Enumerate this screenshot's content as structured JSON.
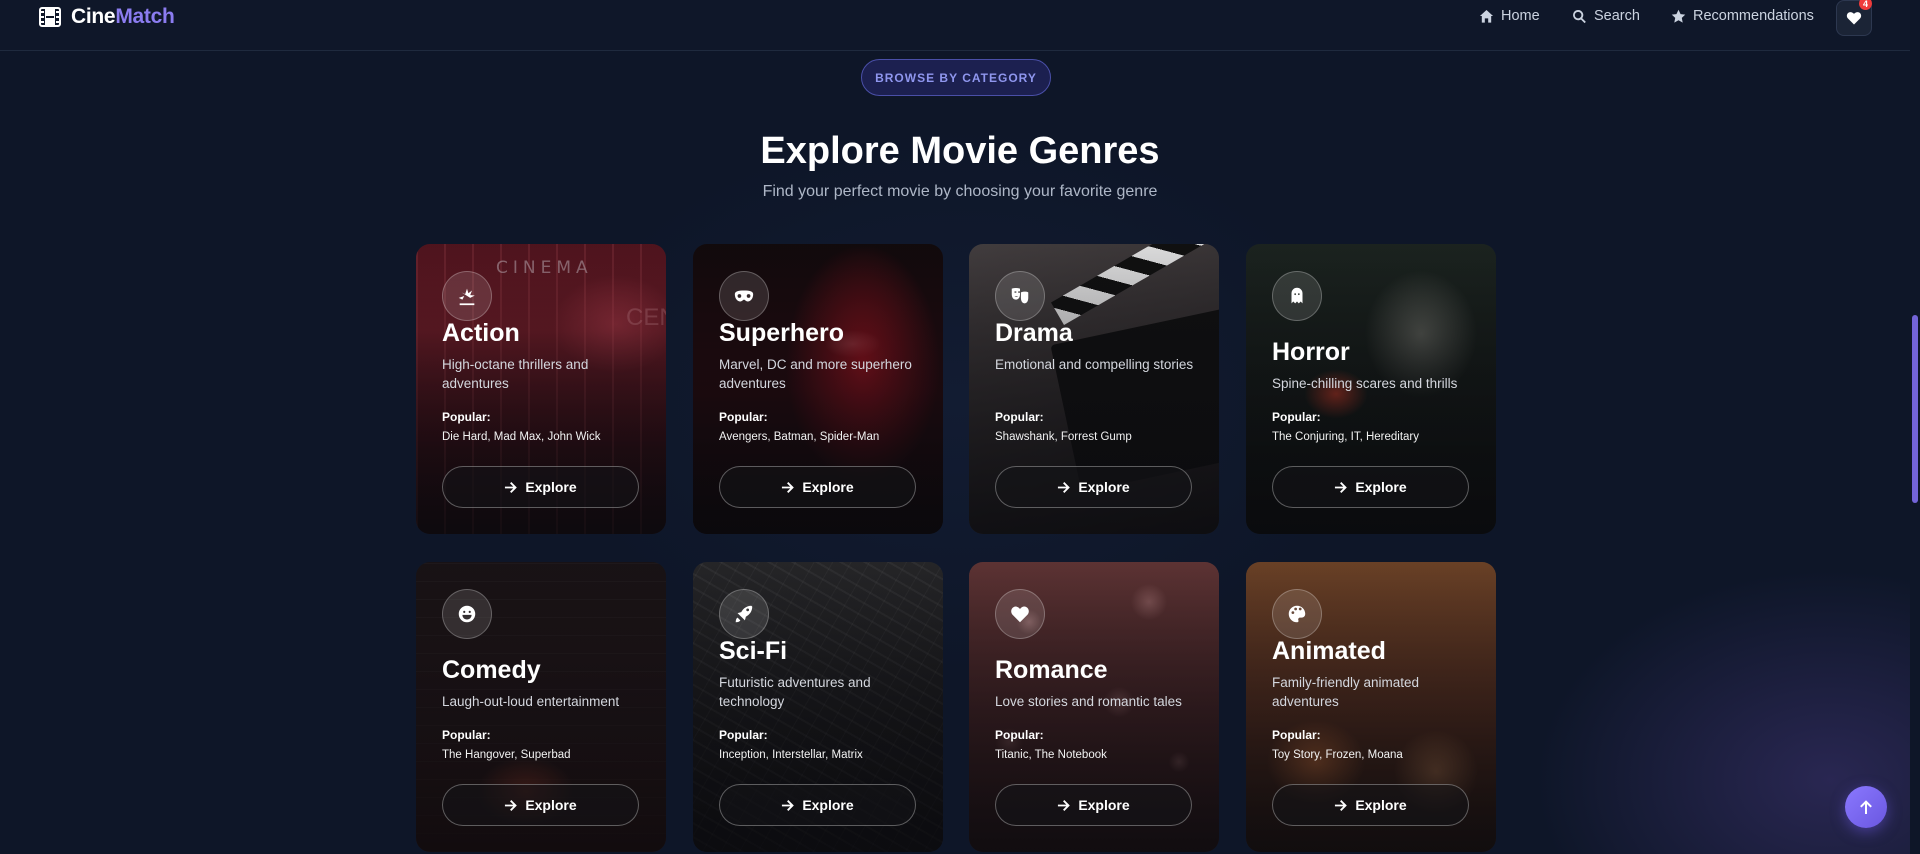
{
  "nav": {
    "brand_a": "Cine",
    "brand_b": "Match",
    "links": [
      {
        "label": "Home",
        "icon": "home-icon"
      },
      {
        "label": "Search",
        "icon": "search-icon"
      },
      {
        "label": "Recommendations",
        "icon": "star-icon"
      }
    ],
    "favorites_count": "4"
  },
  "header": {
    "pill": "BROWSE BY CATEGORY",
    "title": "Explore Movie Genres",
    "subtitle": "Find your perfect movie by choosing your favorite genre"
  },
  "popular_label": "Popular:",
  "explore_label": "Explore",
  "genres": [
    {
      "name": "Action",
      "desc": "High-octane thrillers and adventures",
      "popular": "Die Hard, Mad Max, John Wick",
      "icon": "explosion-icon"
    },
    {
      "name": "Superhero",
      "desc": "Marvel, DC and more superhero adventures",
      "popular": "Avengers, Batman, Spider-Man",
      "icon": "mask-icon"
    },
    {
      "name": "Drama",
      "desc": "Emotional and compelling stories",
      "popular": "Shawshank, Forrest Gump",
      "icon": "theater-masks-icon"
    },
    {
      "name": "Horror",
      "desc": "Spine-chilling scares and thrills",
      "popular": "The Conjuring, IT, Hereditary",
      "icon": "ghost-icon"
    },
    {
      "name": "Comedy",
      "desc": "Laugh-out-loud entertainment",
      "popular": "The Hangover, Superbad",
      "icon": "laugh-icon"
    },
    {
      "name": "Sci-Fi",
      "desc": "Futuristic adventures and technology",
      "popular": "Inception, Interstellar, Matrix",
      "icon": "rocket-icon"
    },
    {
      "name": "Romance",
      "desc": "Love stories and romantic tales",
      "popular": "Titanic, The Notebook",
      "icon": "heart-icon"
    },
    {
      "name": "Animated",
      "desc": "Family-friendly animated adventures",
      "popular": "Toy Story, Frozen, Moana",
      "icon": "palette-icon"
    }
  ],
  "colors": {
    "accent": "#8b7cf0",
    "background": "#0e1628",
    "badge": "#ef3b3b"
  }
}
